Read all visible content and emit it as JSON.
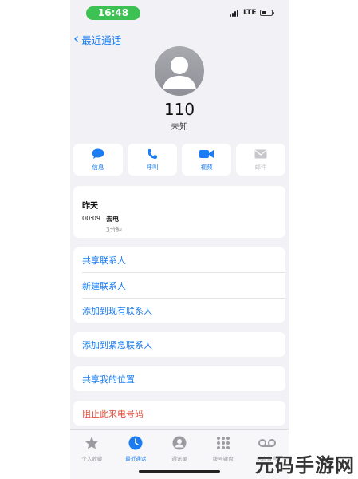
{
  "status_bar": {
    "time": "16:48",
    "network": "LTE",
    "colors": {
      "time_pill": "#3cc152"
    }
  },
  "nav": {
    "back_label": "最近通话",
    "back_icon": "chevron-left-icon"
  },
  "contact": {
    "number": "110",
    "label": "未知",
    "avatar_icon": "person-silhouette-icon"
  },
  "actions": [
    {
      "label": "信息",
      "icon": "message-bubble-icon",
      "enabled": true
    },
    {
      "label": "呼叫",
      "icon": "phone-icon",
      "enabled": true
    },
    {
      "label": "视频",
      "icon": "video-camera-icon",
      "enabled": true
    },
    {
      "label": "邮件",
      "icon": "mail-icon",
      "enabled": false
    }
  ],
  "recent": {
    "day": "昨天",
    "time": "00:09",
    "type": "去电",
    "duration": "3分钟"
  },
  "options": [
    "共享联系人",
    "新建联系人",
    "添加到现有联系人"
  ],
  "emergency_option": "添加到紧急联系人",
  "share_location_option": "共享我的位置",
  "block_option": "阻止此来电号码",
  "tabs": [
    {
      "label": "个人收藏",
      "icon": "star-icon",
      "active": false
    },
    {
      "label": "最近通话",
      "icon": "clock-icon",
      "active": true
    },
    {
      "label": "通讯录",
      "icon": "contacts-icon",
      "active": false
    },
    {
      "label": "拨号键盘",
      "icon": "keypad-icon",
      "active": false
    },
    {
      "label": "语音留言",
      "icon": "voicemail-icon",
      "active": false
    }
  ],
  "watermark": "元码手游网",
  "colors": {
    "accent": "#1a7cf0",
    "destructive": "#e14b3b",
    "background": "#f2f2f6",
    "inactive": "#9b9ba1"
  }
}
